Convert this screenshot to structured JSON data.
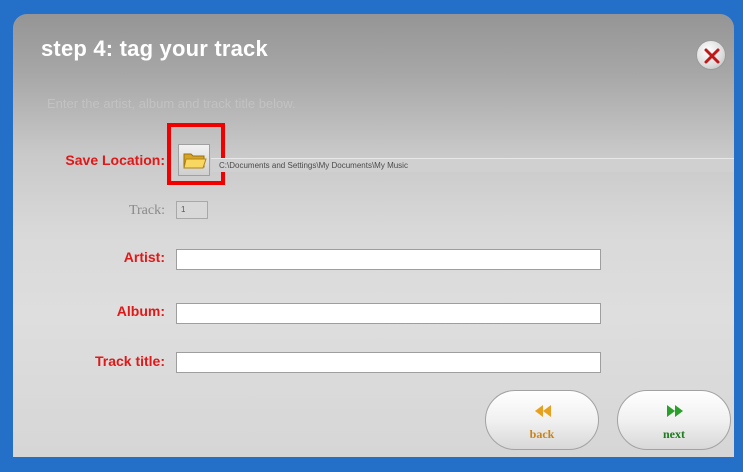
{
  "dialog": {
    "title": "step 4: tag your track",
    "subtitle": "Enter the artist, album and track title below."
  },
  "form": {
    "save_location_label": "Save Location:",
    "save_location_path": "C:\\Documents and Settings\\My Documents\\My Music",
    "track_label": "Track:",
    "track_value": "1",
    "artist_label": "Artist:",
    "artist_value": "",
    "album_label": "Album:",
    "album_value": "",
    "track_title_label": "Track title:",
    "track_title_value": ""
  },
  "buttons": {
    "back_label": "back",
    "next_label": "next"
  },
  "icons": {
    "close": "close-icon",
    "folder": "folder-icon",
    "back": "rewind-icon",
    "next": "fast-forward-icon"
  },
  "colors": {
    "label_red": "#e01818",
    "back_arrow": "#e8a020",
    "next_arrow": "#2aa02a",
    "highlight": "#f20000",
    "frame_blue": "#2470c9"
  }
}
